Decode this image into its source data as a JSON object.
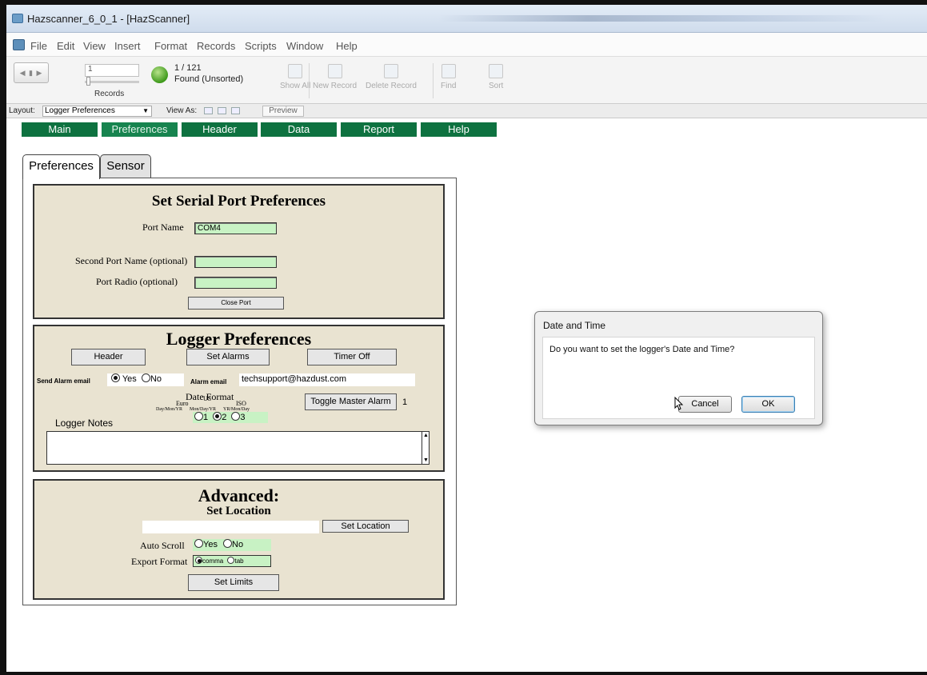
{
  "window": {
    "title": "Hazscanner_6_0_1 - [HazScanner]"
  },
  "menu": [
    "File",
    "Edit",
    "View",
    "Insert",
    "Format",
    "Records",
    "Scripts",
    "Window",
    "Help"
  ],
  "toolbar": {
    "record_value": "1",
    "records_label": "Records",
    "found_count": "1 / 121",
    "found_status": "Found (Unsorted)",
    "show_all": "Show All",
    "new_record": "New Record",
    "delete_record": "Delete Record",
    "find": "Find",
    "sort": "Sort"
  },
  "layoutbar": {
    "layout_label": "Layout:",
    "layout_value": "Logger Preferences",
    "view_as_label": "View As:",
    "preview_label": "Preview"
  },
  "nav_tabs": [
    "Main",
    "Preferences",
    "Header",
    "Data",
    "Report",
    "Help"
  ],
  "form_tabs": [
    "Preferences",
    "Sensor"
  ],
  "serial": {
    "heading": "Set Serial Port Preferences",
    "port_name_label": "Port Name",
    "port_name_value": "COM4",
    "second_port_label": "Second Port Name (optional)",
    "second_port_value": "",
    "port_radio_label": "Port Radio (optional)",
    "port_radio_value": "",
    "close_port": "Close Port"
  },
  "logger": {
    "heading": "Logger Preferences",
    "header_btn": "Header",
    "set_alarms_btn": "Set Alarms",
    "timer_off_btn": "Timer Off",
    "send_alarm_label": "Send Alarm email",
    "yes": "Yes",
    "no": "No",
    "send_alarm_selected": "Yes",
    "alarm_email_label": "Alarm email",
    "alarm_email_value": "techsupport@hazdust.com",
    "date_format_label": "Date Format",
    "fmt_names": [
      "Euro",
      "US",
      "ISO"
    ],
    "fmt_patterns": [
      "Day/Mon/YR",
      "Mon/Day/YR",
      "YR/Mon/Day"
    ],
    "fmt_options": [
      "1",
      "2",
      "3"
    ],
    "fmt_selected": "2",
    "toggle_master_alarm": "Toggle Master Alarm",
    "master_alarm_value": "1",
    "notes_label": "Logger Notes",
    "notes_value": ""
  },
  "advanced": {
    "heading": "Advanced:",
    "subheading": "Set Location",
    "location_value": "",
    "set_location_btn": "Set Location",
    "auto_scroll_label": "Auto Scroll",
    "yes": "Yes",
    "no": "No",
    "export_format_label": "Export Format",
    "comma": "comma",
    "tab": "tab",
    "export_selected": "comma",
    "set_limits_btn": "Set Limits"
  },
  "dialog": {
    "title": "Date and Time",
    "message": "Do you want to set the logger's Date and Time?",
    "cancel": "Cancel",
    "ok": "OK"
  },
  "colors": {
    "nav_tab": "#0e7240",
    "panel_bg": "#e9e3d1",
    "field_bg": "#c8f2c4"
  }
}
